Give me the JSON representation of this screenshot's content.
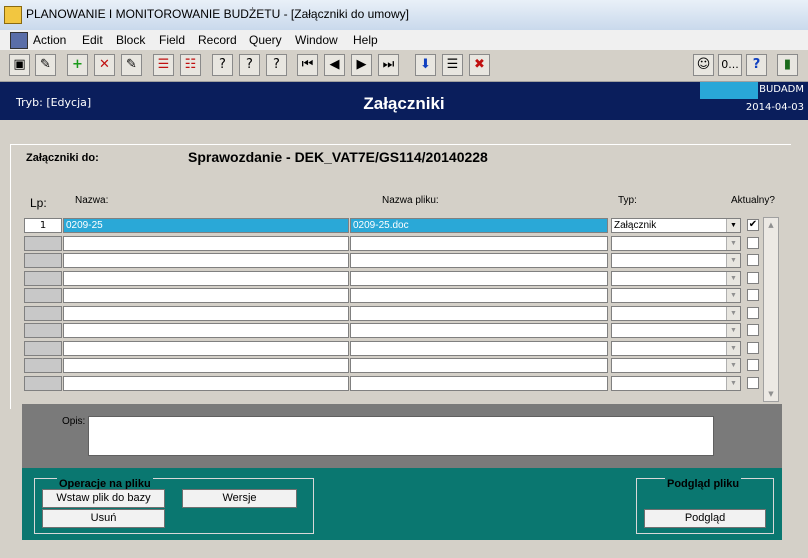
{
  "window": {
    "title": "PLANOWANIE I MONITOROWANIE BUDŻETU - [Załączniki do umowy]"
  },
  "menu": [
    "Action",
    "Edit",
    "Block",
    "Field",
    "Record",
    "Query",
    "Window",
    "Help"
  ],
  "toolbar": {
    "left_icons": [
      "save-icon",
      "clear-icon",
      "insert-record-icon",
      "delete-record-icon",
      "edit-icon",
      "enter-query-icon",
      "execute-query-icon",
      "query-1-icon",
      "query-2-icon",
      "query-3-icon",
      "first-record-icon",
      "previous-record-icon",
      "next-record-icon",
      "last-record-icon",
      "download-icon",
      "list-icon",
      "exit-form-icon"
    ],
    "right_icons": [
      "help-book-icon",
      "help-icon",
      "exit-icon"
    ],
    "zero_button": "0..."
  },
  "header": {
    "mode": "Tryb: [Edycja]",
    "title": "Załączniki",
    "user": "BUDADM",
    "date": "2014-04-03"
  },
  "form": {
    "attachments_for_label": "Załączniki do:",
    "attachments_for_value": "Sprawozdanie - DEK_VAT7E/GS114/20140228",
    "columns": {
      "lp": "Lp:",
      "nazwa": "Nazwa:",
      "nazwa_pliku": "Nazwa pliku:",
      "typ": "Typ:",
      "aktualny": "Aktualny?"
    },
    "rows": [
      {
        "lp": "1",
        "nazwa": "0209-25",
        "nazwa_pliku": "0209-25.doc",
        "typ": "Załącznik",
        "aktualny": "✔"
      },
      {
        "lp": "",
        "nazwa": "",
        "nazwa_pliku": "",
        "typ": "",
        "aktualny": ""
      },
      {
        "lp": "",
        "nazwa": "",
        "nazwa_pliku": "",
        "typ": "",
        "aktualny": ""
      },
      {
        "lp": "",
        "nazwa": "",
        "nazwa_pliku": "",
        "typ": "",
        "aktualny": ""
      },
      {
        "lp": "",
        "nazwa": "",
        "nazwa_pliku": "",
        "typ": "",
        "aktualny": ""
      },
      {
        "lp": "",
        "nazwa": "",
        "nazwa_pliku": "",
        "typ": "",
        "aktualny": ""
      },
      {
        "lp": "",
        "nazwa": "",
        "nazwa_pliku": "",
        "typ": "",
        "aktualny": ""
      },
      {
        "lp": "",
        "nazwa": "",
        "nazwa_pliku": "",
        "typ": "",
        "aktualny": ""
      },
      {
        "lp": "",
        "nazwa": "",
        "nazwa_pliku": "",
        "typ": "",
        "aktualny": ""
      },
      {
        "lp": "",
        "nazwa": "",
        "nazwa_pliku": "",
        "typ": "",
        "aktualny": ""
      }
    ],
    "opis_label": "Opis:",
    "opis_value": ""
  },
  "file_ops": {
    "title": "Operacje na pliku",
    "insert": "Wstaw plik do bazy",
    "versions": "Wersje",
    "delete": "Usuń"
  },
  "preview": {
    "title": "Podgląd pliku",
    "button": "Podgląd"
  }
}
